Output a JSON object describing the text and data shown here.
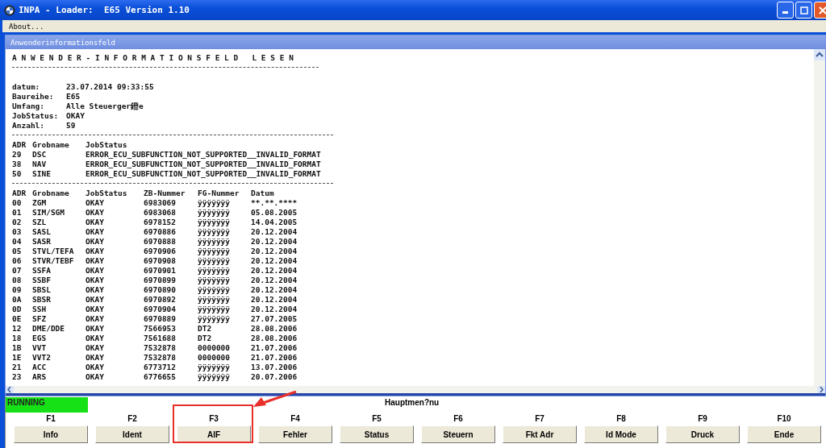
{
  "window": {
    "title": "INPA - Loader:  E65 Version 1.10"
  },
  "menu": [
    "About..."
  ],
  "panel": {
    "title": "Anwenderinformationsfeld"
  },
  "heading": "A N W E N D E R - I N F O R M A T I O N S F E L D   L E S E N",
  "info": [
    {
      "label": "datum:",
      "value": "23.07.2014 09:33:55"
    },
    {
      "label": "Baureihe:",
      "value": "E65"
    },
    {
      "label": "Umfang:",
      "value": "Alle Steuerger鐙e"
    },
    {
      "label": "JobStatus:",
      "value": "OKAY"
    },
    {
      "label": "Anzahl:",
      "value": "59"
    }
  ],
  "error_table": {
    "columns": [
      "ADR",
      "Grobname",
      "JobStatus"
    ],
    "rows": [
      [
        "29",
        "DSC",
        "ERROR_ECU_SUBFUNCTION_NOT_SUPPORTED__INVALID_FORMAT"
      ],
      [
        "38",
        "NAV",
        "ERROR_ECU_SUBFUNCTION_NOT_SUPPORTED__INVALID_FORMAT"
      ],
      [
        "50",
        "SINE",
        "ERROR_ECU_SUBFUNCTION_NOT_SUPPORTED__INVALID_FORMAT"
      ]
    ]
  },
  "ecu_table": {
    "columns": [
      "ADR",
      "Grobname",
      "JobStatus",
      "ZB-Nummer",
      "FG-Nummer",
      "Datum"
    ],
    "rows": [
      [
        "00",
        "ZGM",
        "OKAY",
        "6983069",
        "ÿÿÿÿÿÿÿ",
        "**.**.****"
      ],
      [
        "01",
        "SIM/SGM",
        "OKAY",
        "6983068",
        "ÿÿÿÿÿÿÿ",
        "05.08.2005"
      ],
      [
        "02",
        "SZL",
        "OKAY",
        "6978152",
        "ÿÿÿÿÿÿÿ",
        "14.04.2005"
      ],
      [
        "03",
        "SASL",
        "OKAY",
        "6970886",
        "ÿÿÿÿÿÿÿ",
        "20.12.2004"
      ],
      [
        "04",
        "SASR",
        "OKAY",
        "6970888",
        "ÿÿÿÿÿÿÿ",
        "20.12.2004"
      ],
      [
        "05",
        "STVL/TEFA",
        "OKAY",
        "6970906",
        "ÿÿÿÿÿÿÿ",
        "20.12.2004"
      ],
      [
        "06",
        "STVR/TEBF",
        "OKAY",
        "6970908",
        "ÿÿÿÿÿÿÿ",
        "20.12.2004"
      ],
      [
        "07",
        "SSFA",
        "OKAY",
        "6970901",
        "ÿÿÿÿÿÿÿ",
        "20.12.2004"
      ],
      [
        "08",
        "SSBF",
        "OKAY",
        "6970899",
        "ÿÿÿÿÿÿÿ",
        "20.12.2004"
      ],
      [
        "09",
        "SBSL",
        "OKAY",
        "6970890",
        "ÿÿÿÿÿÿÿ",
        "20.12.2004"
      ],
      [
        "0A",
        "SBSR",
        "OKAY",
        "6970892",
        "ÿÿÿÿÿÿÿ",
        "20.12.2004"
      ],
      [
        "0D",
        "SSH",
        "OKAY",
        "6970904",
        "ÿÿÿÿÿÿÿ",
        "20.12.2004"
      ],
      [
        "0E",
        "SFZ",
        "OKAY",
        "6970889",
        "ÿÿÿÿÿÿÿ",
        "27.07.2005"
      ],
      [
        "12",
        "DME/DDE",
        "OKAY",
        "7566953",
        "DT2",
        "28.08.2006"
      ],
      [
        "18",
        "EGS",
        "OKAY",
        "7561688",
        "DT2",
        "28.08.2006"
      ],
      [
        "1B",
        "VVT",
        "OKAY",
        "7532878",
        "0000000",
        "21.07.2006"
      ],
      [
        "1E",
        "VVT2",
        "OKAY",
        "7532878",
        "0000000",
        "21.07.2006"
      ],
      [
        "21",
        "ACC",
        "OKAY",
        "6773712",
        "ÿÿÿÿÿÿÿ",
        "13.07.2006"
      ],
      [
        "23",
        "ARS",
        "OKAY",
        "6776655",
        "ÿÿÿÿÿÿÿ",
        "20.07.2006"
      ]
    ]
  },
  "status": "RUNNING",
  "menu_title": "Hauptmen?nu",
  "function_keys": [
    {
      "key": "F1",
      "label": "Info",
      "highlighted": false
    },
    {
      "key": "F2",
      "label": "Ident",
      "highlighted": false
    },
    {
      "key": "F3",
      "label": "AIF",
      "highlighted": true
    },
    {
      "key": "F4",
      "label": "Fehler",
      "highlighted": false
    },
    {
      "key": "F5",
      "label": "Status",
      "highlighted": false
    },
    {
      "key": "F6",
      "label": "Steuern",
      "highlighted": false
    },
    {
      "key": "F7",
      "label": "Fkt Adr",
      "highlighted": false
    },
    {
      "key": "F8",
      "label": "Id Mode",
      "highlighted": false
    },
    {
      "key": "F9",
      "label": "Druck",
      "highlighted": false
    },
    {
      "key": "F10",
      "label": "Ende",
      "highlighted": false
    }
  ]
}
